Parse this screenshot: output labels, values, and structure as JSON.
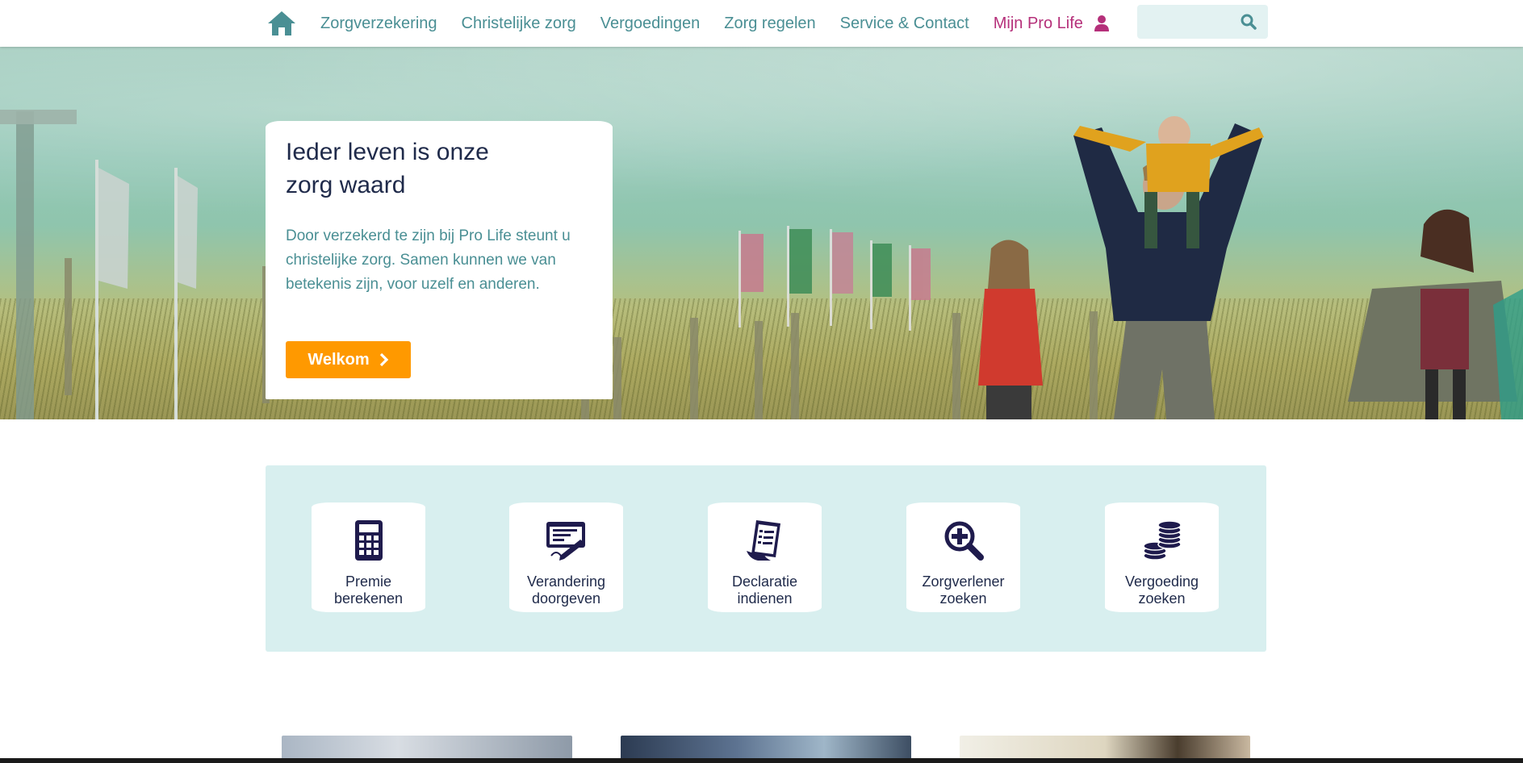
{
  "nav": {
    "items": [
      {
        "label": "Zorgverzekering"
      },
      {
        "label": "Christelijke zorg"
      },
      {
        "label": "Vergoedingen"
      },
      {
        "label": "Zorg regelen"
      },
      {
        "label": "Service & Contact"
      }
    ],
    "account_label": "Mijn Pro Life",
    "search": {
      "placeholder": "",
      "value": ""
    }
  },
  "hero": {
    "title_line1": "Ieder leven is onze",
    "title_line2": "zorg waard",
    "text": "Door verzekerd te zijn bij Pro Life steunt u christelijke zorg. Samen kunnen we van betekenis zijn, voor uzelf en anderen.",
    "cta_label": "Welkom"
  },
  "quick_links": [
    {
      "line1": "Premie",
      "line2": "berekenen",
      "icon": "calculator-icon"
    },
    {
      "line1": "Verandering",
      "line2": "doorgeven",
      "icon": "form-pen-icon"
    },
    {
      "line1": "Declaratie",
      "line2": "indienen",
      "icon": "receipt-icon"
    },
    {
      "line1": "Zorgverlener",
      "line2": "zoeken",
      "icon": "magnifier-plus-icon"
    },
    {
      "line1": "Vergoeding",
      "line2": "zoeken",
      "icon": "coins-icon"
    }
  ],
  "colors": {
    "nav_text": "#4a8f94",
    "account": "#b5307a",
    "cta": "#ff9900",
    "panel": "#d8efef",
    "icon": "#1f1b4d"
  }
}
